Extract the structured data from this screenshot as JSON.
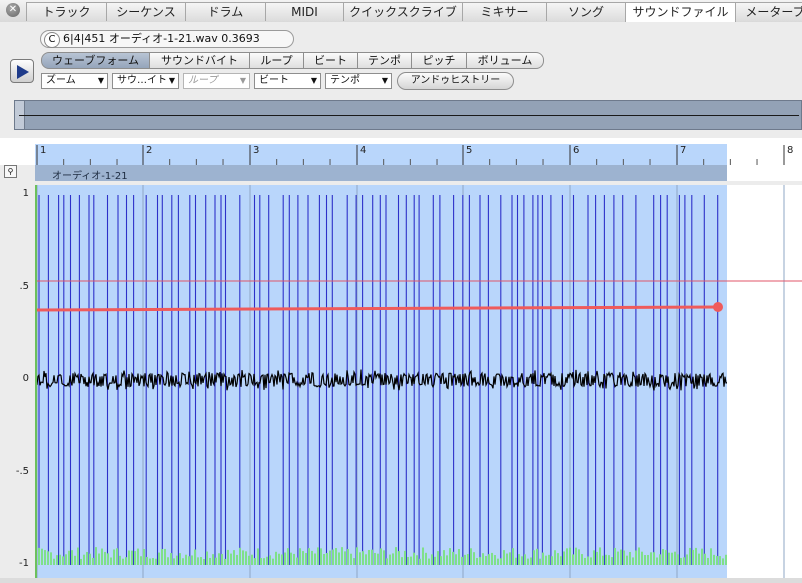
{
  "tabs": [
    "トラック",
    "シーケンス",
    "ドラム",
    "MIDI",
    "クイックスクライブ",
    "ミキサー",
    "ソング",
    "サウンドファイル",
    "メーターブ"
  ],
  "active_tab": "サウンドファイル",
  "info": {
    "badge": "C",
    "text": "6|4|451  オーディオ-1-21.wav  0.3693"
  },
  "modes": [
    "ウェーブフォーム",
    "サウンドバイト",
    "ループ",
    "ビート",
    "テンポ",
    "ピッチ",
    "ボリューム"
  ],
  "active_mode": "ウェーブフォーム",
  "dropdowns": [
    {
      "label": "ズーム",
      "disabled": false
    },
    {
      "label": "サウ…イト",
      "disabled": false
    },
    {
      "label": "ループ",
      "disabled": true
    },
    {
      "label": "ビート",
      "disabled": false
    },
    {
      "label": "テンポ",
      "disabled": false
    }
  ],
  "undo_label": "アンドゥヒストリー",
  "ruler_ticks": [
    "1",
    "2",
    "3",
    "4",
    "5",
    "6",
    "7",
    "8"
  ],
  "region_label": "オーディオ-1-21",
  "y_axis_labels": [
    "1",
    ".5",
    "0",
    "-.5",
    "-1"
  ],
  "colors": {
    "selection": "#b9d6fb",
    "beat_line": "#2d31c9",
    "waveform": "#000000",
    "threshold_line": "#e0556a",
    "volume_line": "#ef5b5b",
    "peaks": "#7fe08a",
    "region": "#9db3d0",
    "playhead": "#6cc05c"
  },
  "icons": {
    "close": "close-icon",
    "play": "play-icon",
    "magnifier": "magnifier-icon"
  }
}
